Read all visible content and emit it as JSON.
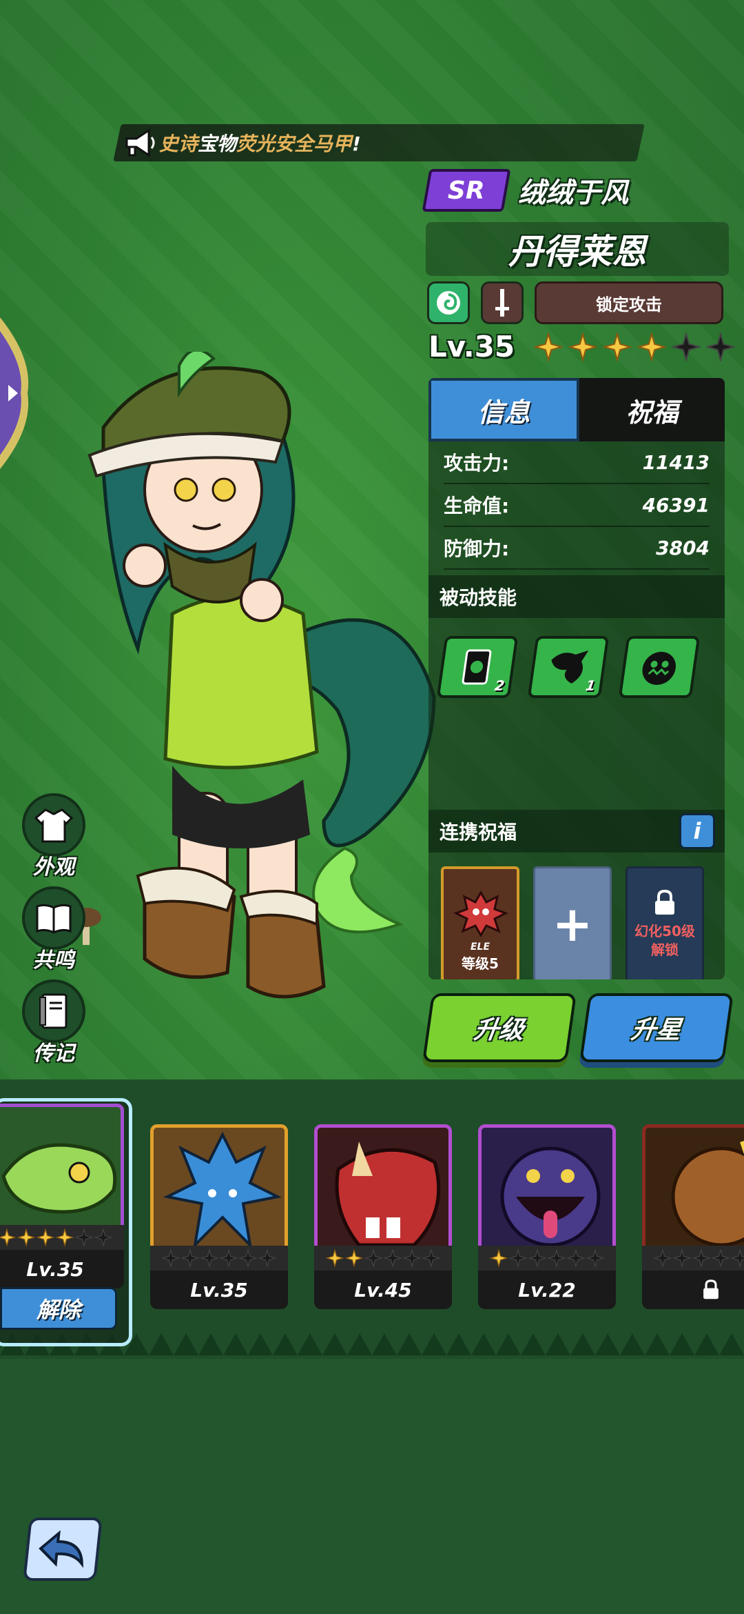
{
  "announcement": {
    "prefix": "史诗",
    "middle": "宝物",
    "item": "荧光安全马甲",
    "suffix": "!"
  },
  "hero": {
    "rarity": "SR",
    "title": "绒绒于风",
    "name": "丹得莱恩",
    "lock_attack_label": "锁定攻击",
    "level": "Lv.35",
    "stars_filled": 4,
    "stars_total": 6
  },
  "tabs": {
    "info": "信息",
    "blessing": "祝福"
  },
  "stats": [
    {
      "label": "攻击力:",
      "value": "11413"
    },
    {
      "label": "生命值:",
      "value": "46391"
    },
    {
      "label": "防御力:",
      "value": "3804"
    }
  ],
  "passive": {
    "header": "被动技能",
    "skills": [
      {
        "icon": "card-skill-icon",
        "count": "2"
      },
      {
        "icon": "beast-claw-skill-icon",
        "count": "1"
      },
      {
        "icon": "monster-face-skill-icon",
        "count": ""
      }
    ]
  },
  "link_blessing": {
    "header": "连携祝福",
    "info_button": "i",
    "pet_ele": "ELE",
    "pet_level": "等级5",
    "locked_line1": "幻化50级",
    "locked_line2": "解锁"
  },
  "actions": {
    "upgrade": "升级",
    "star_up": "升星"
  },
  "side_menu": [
    {
      "label": "外观",
      "icon": "shirt-icon"
    },
    {
      "label": "共鸣",
      "icon": "book-icon"
    },
    {
      "label": "传记",
      "icon": "notebook-icon"
    }
  ],
  "roster": [
    {
      "level": "Lv.35",
      "stars": 4,
      "frame": "#a24ed0",
      "selected": true,
      "action": "解除"
    },
    {
      "level": "Lv.35",
      "stars": 0,
      "frame": "#e2a02b",
      "selected": false
    },
    {
      "level": "Lv.45",
      "stars": 2,
      "frame": "#b24ed0",
      "selected": false
    },
    {
      "level": "Lv.22",
      "stars": 1,
      "frame": "#b24ed0",
      "selected": false
    },
    {
      "level": "",
      "stars": 0,
      "frame": "#8a2a20",
      "selected": false,
      "locked": true
    }
  ],
  "colors": {
    "accent_blue": "#3f8fd8",
    "accent_green": "#7ad130",
    "rarity_purple": "#7e3fd6",
    "star_gold": "#f5c842"
  }
}
